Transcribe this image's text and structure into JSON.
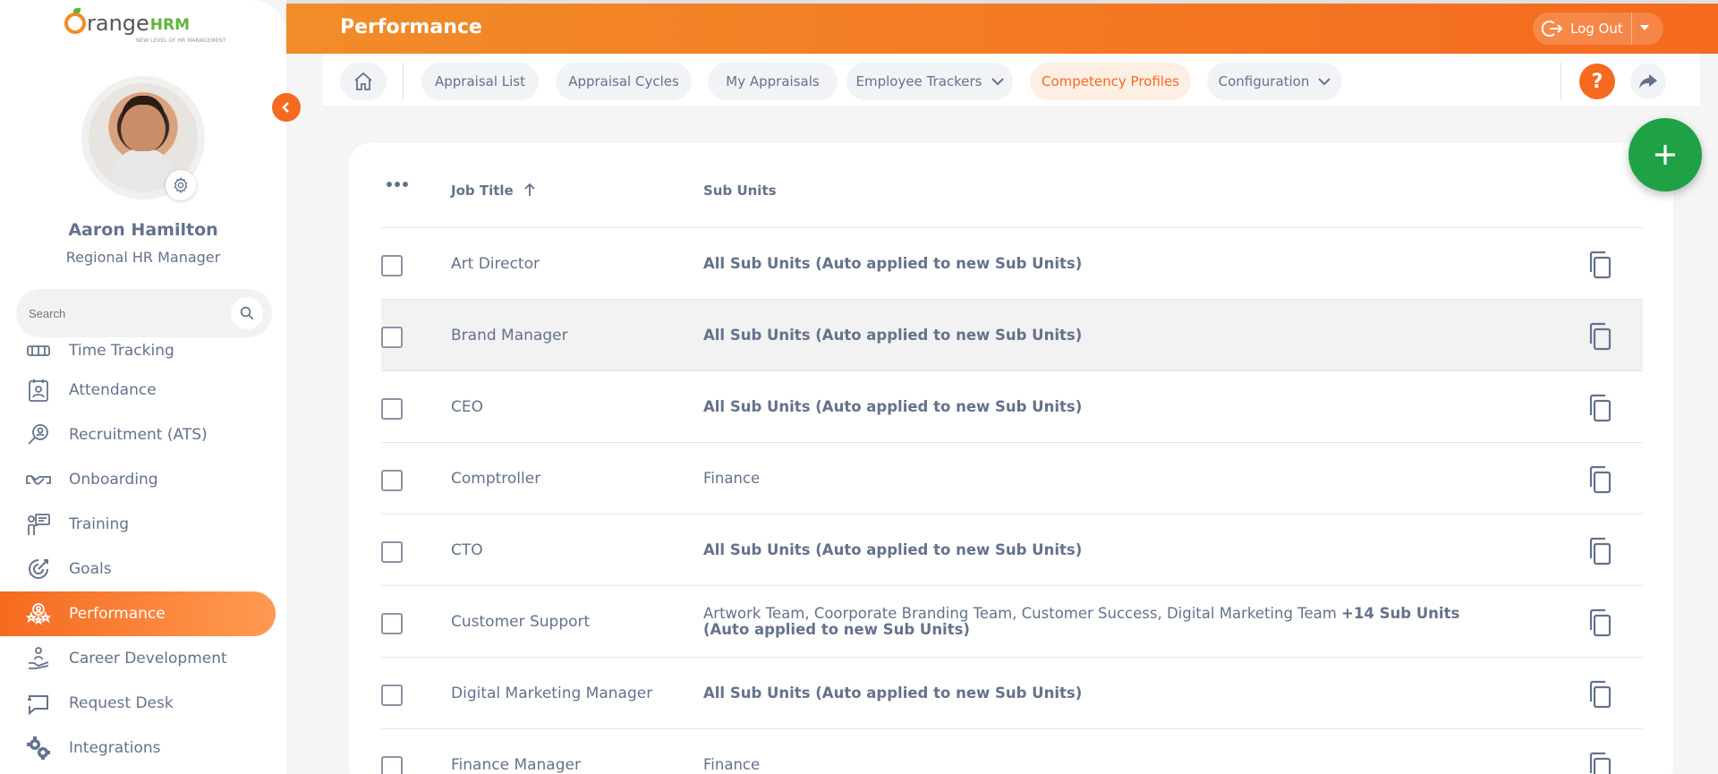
{
  "app": {
    "logo_main": "range",
    "logo_brand": "HRM",
    "logo_tagline": "NEW LEVEL OF HR MANAGEMENT"
  },
  "user": {
    "name": "Aaron Hamilton",
    "role": "Regional HR Manager"
  },
  "sidebar": {
    "search_placeholder": "Search",
    "items": [
      {
        "label": "Time Tracking",
        "icon": "time-tracking-icon"
      },
      {
        "label": "Attendance",
        "icon": "attendance-icon"
      },
      {
        "label": "Recruitment (ATS)",
        "icon": "recruitment-icon"
      },
      {
        "label": "Onboarding",
        "icon": "onboarding-icon"
      },
      {
        "label": "Training",
        "icon": "training-icon"
      },
      {
        "label": "Goals",
        "icon": "goals-icon"
      },
      {
        "label": "Performance",
        "icon": "performance-icon",
        "active": true
      },
      {
        "label": "Career Development",
        "icon": "career-development-icon"
      },
      {
        "label": "Request Desk",
        "icon": "request-desk-icon"
      },
      {
        "label": "Integrations",
        "icon": "integrations-icon"
      }
    ]
  },
  "header": {
    "title": "Performance",
    "logout_label": "Log Out"
  },
  "subnav": {
    "items": [
      {
        "label": "Appraisal List"
      },
      {
        "label": "Appraisal Cycles"
      },
      {
        "label": "My Appraisals"
      },
      {
        "label": "Employee Trackers"
      },
      {
        "label": "Competency Profiles",
        "active": true
      },
      {
        "label": "Configuration"
      }
    ],
    "help_label": "?"
  },
  "table": {
    "headers": {
      "job_title": "Job Title",
      "sub_units": "Sub Units"
    },
    "rows": [
      {
        "title": "Art Director",
        "units_plain": "",
        "units_bold": "All Sub Units (Auto applied to new Sub Units)"
      },
      {
        "title": "Brand Manager",
        "units_plain": "",
        "units_bold": "All Sub Units (Auto applied to new Sub Units)"
      },
      {
        "title": "CEO",
        "units_plain": "",
        "units_bold": "All Sub Units (Auto applied to new Sub Units)"
      },
      {
        "title": "Comptroller",
        "units_plain": "Finance",
        "units_bold": ""
      },
      {
        "title": "CTO",
        "units_plain": "",
        "units_bold": "All Sub Units (Auto applied to new Sub Units)"
      },
      {
        "title": "Customer Support",
        "units_plain": "Artwork Team, Coorporate Branding Team, Customer Success, Digital Marketing Team ",
        "units_bold": "+14 Sub Units (Auto applied to new Sub Units)"
      },
      {
        "title": "Digital Marketing Manager",
        "units_plain": "",
        "units_bold": "All Sub Units (Auto applied to new Sub Units)"
      },
      {
        "title": "Finance Manager",
        "units_plain": "Finance",
        "units_bold": ""
      }
    ]
  },
  "colors": {
    "accent": "#f56a1f",
    "fab": "#1fa146",
    "text": "#64728c"
  }
}
